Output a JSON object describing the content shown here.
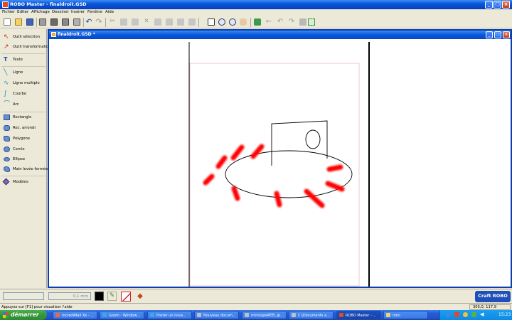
{
  "window": {
    "title": "ROBO Master - finaldroit.GSD"
  },
  "menu": [
    "Fichier",
    "Editer",
    "Affichage",
    "Dessiner",
    "Insérer",
    "Fenêtre",
    "Aide"
  ],
  "tools": [
    {
      "label": "Outil sélection",
      "icon": "pointer-icon"
    },
    {
      "label": "Outil transformation",
      "icon": "transform-icon"
    },
    {
      "label": "Texte",
      "icon": "text-icon"
    },
    {
      "label": "Ligne",
      "icon": "line-icon"
    },
    {
      "label": "Ligne multiple",
      "icon": "polyline-icon"
    },
    {
      "label": "Courbe",
      "icon": "curve-icon"
    },
    {
      "label": "Arc",
      "icon": "arc-icon"
    },
    {
      "label": "Rectangle",
      "icon": "rectangle-icon"
    },
    {
      "label": "Rec. arrondi",
      "icon": "rounded-rectangle-icon"
    },
    {
      "label": "Polygone",
      "icon": "polygon-icon"
    },
    {
      "label": "Cercle",
      "icon": "circle-icon"
    },
    {
      "label": "Ellipse",
      "icon": "ellipse-icon"
    },
    {
      "label": "Main levée fermée",
      "icon": "freehand-icon"
    },
    {
      "label": "Modèles",
      "icon": "templates-icon"
    }
  ],
  "document": {
    "title": "finaldroit.GSD *"
  },
  "bottom": {
    "line_width": "0,1 mm",
    "logo": "Craft ROBO"
  },
  "status": {
    "help": "Appuyez sur [F1] pour  visualiser l'aide",
    "coords": "305,0, 117,9"
  },
  "taskbar": {
    "start": "démarrer",
    "tasks": [
      "IncrediMail Xe - ...",
      "Goom - Window...",
      "Poster un nouv...",
      "Nouveau docum...",
      "minisigleREEL.jp...",
      "C:\\Documents a...",
      "ROBO Master - ...",
      "mini"
    ],
    "time": "15:23"
  },
  "colors": {
    "accent": "#0a56d8",
    "marks": "#ff0000",
    "taskbar": "#245edb",
    "start": "#37973a"
  }
}
